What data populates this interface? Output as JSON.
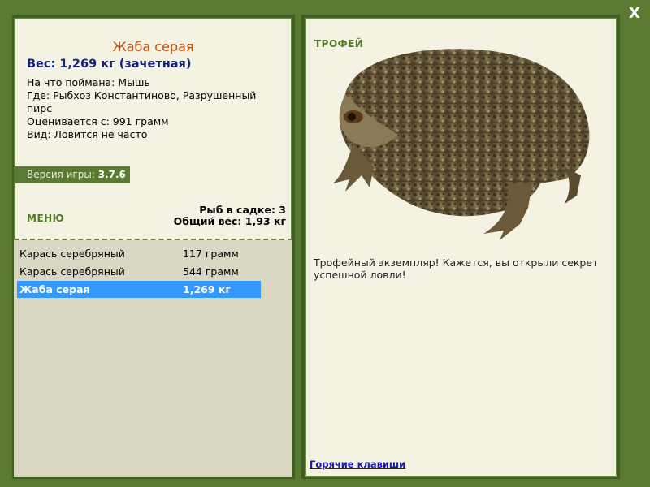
{
  "close_label": "X",
  "fish": {
    "title": "Жаба серая",
    "weight_line": "Вес: 1,269 кг (зачетная)",
    "bait": "На что поймана: Мышь",
    "location": "Где: Рыбхоз Константиново, Разрушенный пирс",
    "rated_from": "Оценивается с: 991 грамм",
    "kind": "Вид: Ловится не часто"
  },
  "version": {
    "label": "Версия игры:",
    "value": "3.7.6"
  },
  "menu_label": "МЕНЮ",
  "stats": {
    "count": "Рыб в садке: 3",
    "total": "Общий вес: 1,93 кг"
  },
  "catch_list": [
    {
      "name": "Карась серебряный",
      "weight": "117 грамм",
      "selected": false
    },
    {
      "name": "Карась серебряный",
      "weight": "544 грамм",
      "selected": false
    },
    {
      "name": "Жаба серая",
      "weight": "1,269 кг",
      "selected": true
    }
  ],
  "trophy_label": "ТРОФЕЙ",
  "trophy_text": "Трофейный экземпляр! Кажется, вы открыли секрет успешной ловли!",
  "hotkeys_label": "Горячие клавиши",
  "colors": {
    "frame": "#5a7a32",
    "panel": "#f3f2e3",
    "title": "#c34a06",
    "weight": "#13237e",
    "selection": "#3399ff"
  }
}
